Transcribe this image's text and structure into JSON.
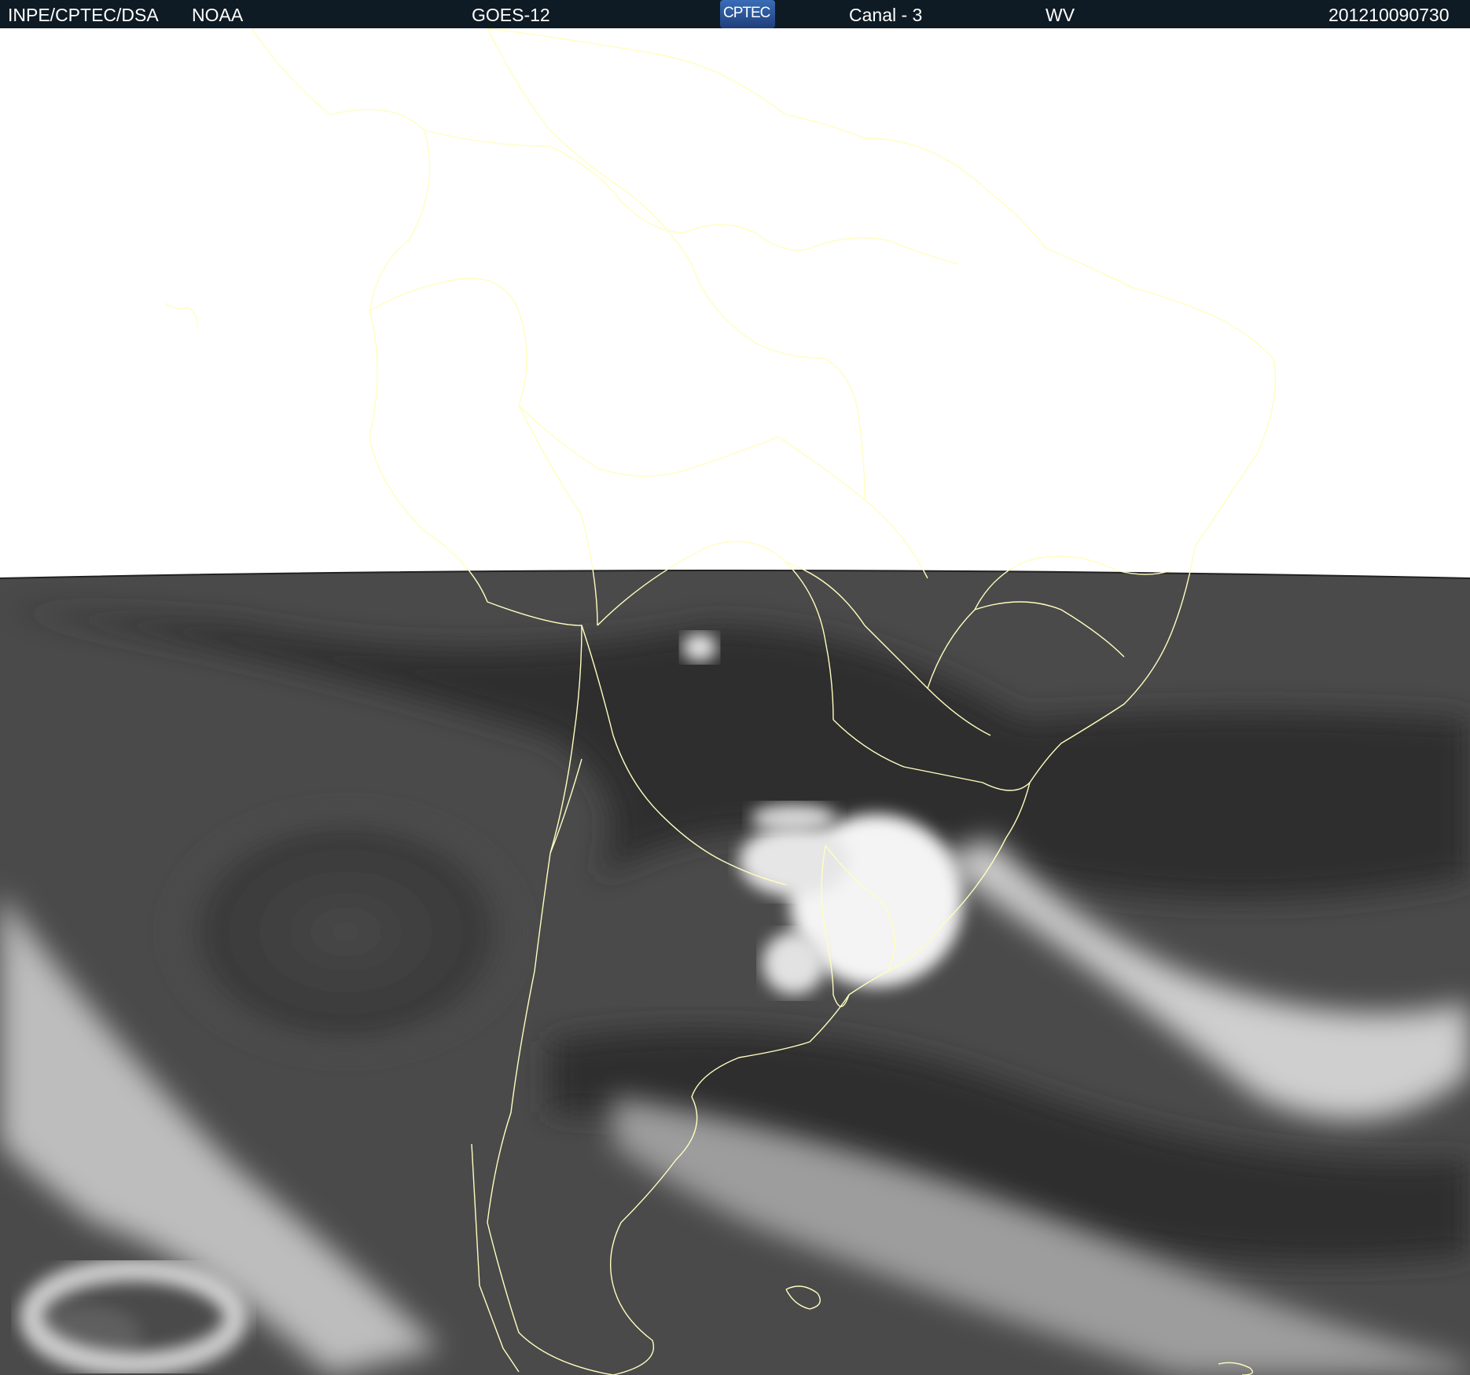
{
  "header": {
    "agency": "INPE/CPTEC/DSA",
    "source": "NOAA",
    "satellite": "GOES-12",
    "logo_text": "CPTEC",
    "channel": "Canal - 3",
    "band": "WV",
    "timestamp": "201210090730"
  },
  "colors": {
    "header_bg": "#0f1b24",
    "coastline": "#fffec0",
    "imagery_dark": "#2b2b2b",
    "cloud": "#f2f2f2"
  },
  "icons": {
    "logo": "cptec-logo"
  }
}
